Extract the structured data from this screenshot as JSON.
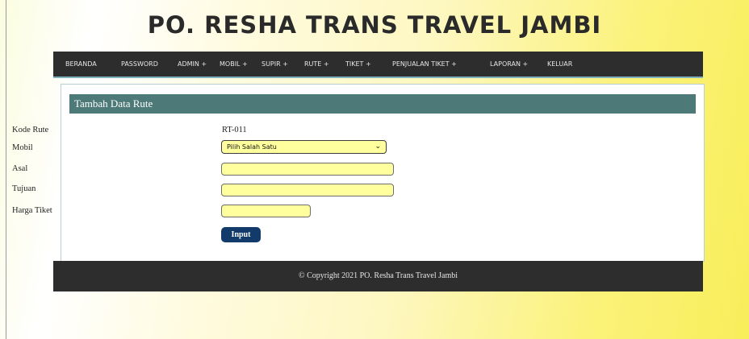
{
  "header": {
    "title": "PO. RESHA TRANS TRAVEL JAMBI"
  },
  "nav": {
    "items": [
      {
        "label": "BERANDA"
      },
      {
        "label": "PASSWORD"
      },
      {
        "label": "ADMIN +"
      },
      {
        "label": "MOBIL +"
      },
      {
        "label": "SUPIR +"
      },
      {
        "label": "RUTE +"
      },
      {
        "label": "TIKET +"
      },
      {
        "label": "PENJUALAN TIKET +"
      },
      {
        "label": "LAPORAN +"
      },
      {
        "label": "KELUAR"
      }
    ]
  },
  "form": {
    "section_title": "Tambah Data Rute",
    "labels": {
      "kode_rute": "Kode Rute",
      "mobil": "Mobil",
      "asal": "Asal",
      "tujuan": "Tujuan",
      "harga_tiket": "Harga Tiket"
    },
    "kode_rute_value": "RT-011",
    "mobil_select_value": "Pilih Salah Satu",
    "asal_value": "",
    "tujuan_value": "",
    "harga_tiket_value": "",
    "submit_label": "Input"
  },
  "footer": {
    "text": "© Copyright 2021 PO. Resha Trans Travel Jambi"
  },
  "colors": {
    "nav_bg": "#2d2d2d",
    "section_header_bg": "#4d7a78",
    "input_bg": "#ffff9e",
    "button_bg": "#123a6a"
  }
}
